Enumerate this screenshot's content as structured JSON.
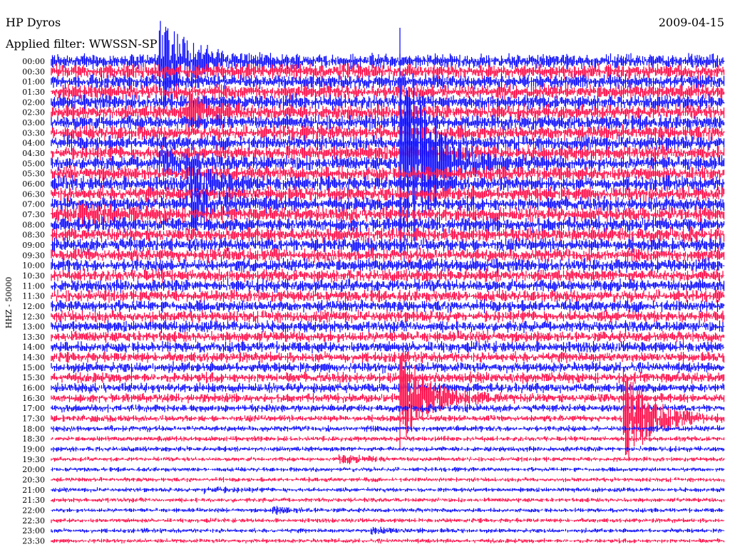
{
  "header": {
    "station": "HP Dyros",
    "date": "2009-04-15",
    "filter": "Applied filter: WWSSN-SP"
  },
  "colors": {
    "trace_a": "#0000ff",
    "trace_b": "#ff0040",
    "background": "#ffffff",
    "text": "#000000"
  },
  "chart_data": {
    "type": "line",
    "description_kind": "helicorder",
    "ylabel": "HHZ - 50000",
    "row_labels": [
      "00:00",
      "00:30",
      "01:00",
      "01:30",
      "02:00",
      "02:30",
      "03:00",
      "03:30",
      "04:00",
      "04:30",
      "05:00",
      "05:30",
      "06:00",
      "06:30",
      "07:00",
      "07:30",
      "08:00",
      "08:30",
      "09:00",
      "09:30",
      "10:00",
      "10:30",
      "11:00",
      "11:30",
      "12:00",
      "12:30",
      "13:00",
      "13:30",
      "14:00",
      "14:30",
      "15:00",
      "15:30",
      "16:00",
      "16:30",
      "17:00",
      "17:30",
      "18:00",
      "18:30",
      "19:00",
      "19:30",
      "20:00",
      "20:30",
      "21:00",
      "21:30",
      "22:00",
      "22:30",
      "23:00",
      "23:30"
    ],
    "row_interval_minutes": 30,
    "trace_colors_alternate": [
      "#0000ff",
      "#ff0040"
    ],
    "noise_level_by_row": [
      1.0,
      1.0,
      1.0,
      1.0,
      1.0,
      1.0,
      1.0,
      1.0,
      1.0,
      1.0,
      1.0,
      1.0,
      1.0,
      1.0,
      1.0,
      1.0,
      1.0,
      0.95,
      0.95,
      0.9,
      0.9,
      0.85,
      0.85,
      0.8,
      0.8,
      0.8,
      0.75,
      0.75,
      0.75,
      0.7,
      0.7,
      0.7,
      0.65,
      0.6,
      0.5,
      0.45,
      0.4,
      0.35,
      0.35,
      0.3,
      0.3,
      0.3,
      0.3,
      0.3,
      0.3,
      0.3,
      0.3,
      0.3
    ],
    "events": [
      {
        "row": 0,
        "minute": 4.8,
        "strength": 8
      },
      {
        "row": 5,
        "minute": 6.0,
        "strength": 3
      },
      {
        "row": 10,
        "minute": 4.8,
        "strength": 2
      },
      {
        "row": 12,
        "minute": 6.0,
        "strength": 3
      },
      {
        "row": 14,
        "minute": 6.2,
        "strength": 3
      },
      {
        "row": 15,
        "minute": 1.2,
        "strength": 2
      },
      {
        "row": 10,
        "minute": 15.5,
        "strength": 22
      },
      {
        "row": 33,
        "minute": 15.5,
        "strength": 14
      },
      {
        "row": 35,
        "minute": 25.5,
        "strength": 18
      },
      {
        "row": 39,
        "minute": 12.8,
        "strength": 2
      },
      {
        "row": 42,
        "minute": 6.8,
        "strength": 1.5
      },
      {
        "row": 44,
        "minute": 9.8,
        "strength": 1.5
      },
      {
        "row": 46,
        "minute": 14.2,
        "strength": 1.5
      }
    ]
  }
}
